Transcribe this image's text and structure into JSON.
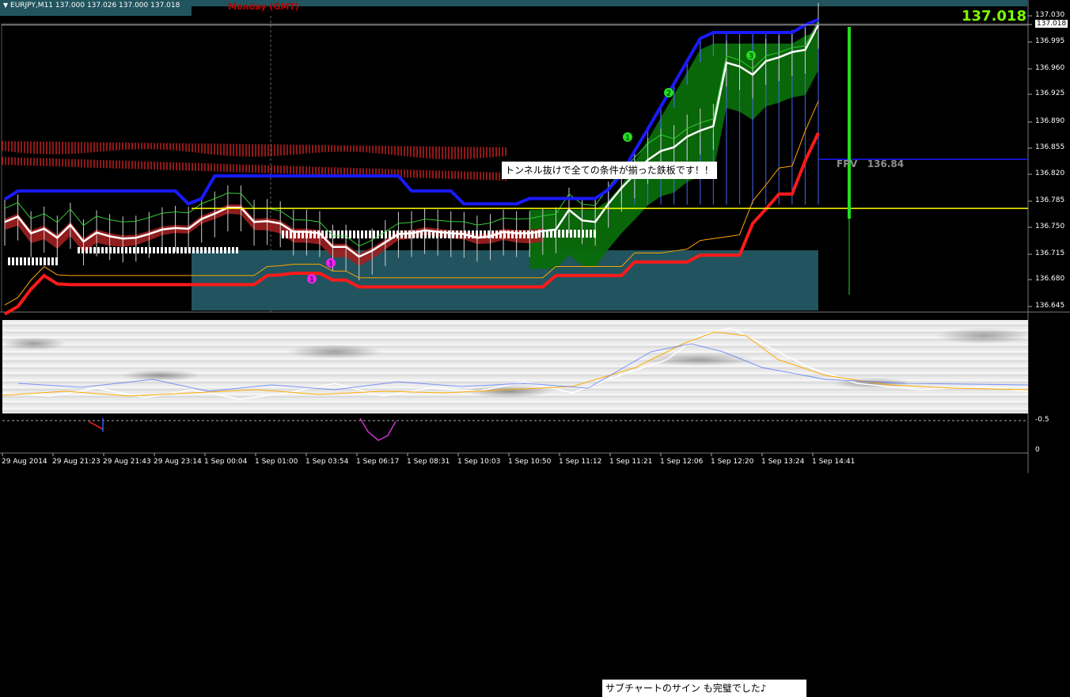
{
  "window": {
    "symbol_line": "EURJPY,M11  137.000 137.026 137.000 137.018",
    "session_label": "Monday    (GMT)",
    "current_price": "137.018",
    "fpv_label": "FPV   136.84"
  },
  "annotations": {
    "main_note": "トンネル抜けで全ての条件が揃った鉄板です！！",
    "sub_note": "サブチャートのサイン も完璧でした♪"
  },
  "signals": [
    {
      "label": "1",
      "color": "#22dd22"
    },
    {
      "label": "2",
      "color": "#22dd22"
    },
    {
      "label": "3",
      "color": "#22dd22"
    },
    {
      "label": "1",
      "color": "#ee22ee"
    },
    {
      "label": "1",
      "color": "#ee22ee"
    }
  ],
  "colors": {
    "background": "#000000",
    "upper_band": "#1a1aff",
    "lower_band": "#ff1a1a",
    "price_line": "#ffffff",
    "cloud_bull": "#0a6b0a",
    "cloud_bear": "#a02020",
    "teal_zone": "#21545e",
    "fpv_line": "#1a1aff",
    "yellow_line": "#ffff00",
    "current_price": "#7cfc00"
  },
  "chart_data": {
    "type": "line",
    "title": "EURJPY,M11",
    "y_axis_ticks": [
      "137.030",
      "137.018",
      "136.995",
      "136.960",
      "136.925",
      "136.890",
      "136.855",
      "136.820",
      "136.785",
      "136.750",
      "136.715",
      "136.680",
      "136.645"
    ],
    "sub_axis_ticks": [
      "-0.5",
      "0"
    ],
    "x_axis_ticks": [
      "29 Aug 2014",
      "29 Aug 21:23",
      "29 Aug 21:43",
      "29 Aug 23:14",
      "1 Sep 00:04",
      "1 Sep 01:00",
      "1 Sep 03:54",
      "1 Sep 06:17",
      "1 Sep 08:31",
      "1 Sep 10:03",
      "1 Sep 10:50",
      "1 Sep 11:12",
      "1 Sep 11:21",
      "1 Sep 12:06",
      "1 Sep 12:20",
      "1 Sep 13:24",
      "1 Sep 14:41"
    ],
    "ylim": [
      136.645,
      137.03
    ],
    "current_price": 137.018,
    "fpv": 136.84,
    "yellow_level": 136.775,
    "series": [
      {
        "values": [
          136.757,
          136.764,
          136.742,
          136.748,
          136.736,
          136.753,
          136.731,
          136.743,
          136.738,
          136.735,
          136.736,
          136.741,
          136.747,
          136.749,
          136.748,
          136.761,
          136.768,
          136.776,
          136.776,
          136.757,
          136.758,
          136.755,
          136.744,
          136.744,
          136.742,
          136.724,
          136.724,
          136.711,
          136.719,
          136.73,
          136.741,
          136.742,
          136.746,
          136.744,
          136.742,
          136.741,
          136.736,
          136.738,
          136.744,
          136.742,
          136.742,
          136.745,
          136.747,
          136.773,
          136.759,
          136.757,
          136.781,
          136.802,
          136.82,
          136.839,
          136.851,
          136.856,
          136.87,
          136.878,
          136.884,
          136.968,
          136.963,
          136.952,
          136.97,
          136.975,
          136.982,
          136.985,
          137.018
        ]
      },
      {
        "values": [
          136.787,
          136.798,
          136.798,
          136.798,
          136.798,
          136.798,
          136.798,
          136.798,
          136.798,
          136.798,
          136.798,
          136.798,
          136.798,
          136.798,
          136.781,
          136.788,
          136.818,
          136.818,
          136.818,
          136.818,
          136.818,
          136.818,
          136.818,
          136.818,
          136.818,
          136.818,
          136.818,
          136.818,
          136.818,
          136.818,
          136.818,
          136.798,
          136.798,
          136.798,
          136.798,
          136.781,
          136.781,
          136.781,
          136.781,
          136.781,
          136.788,
          136.788,
          136.788,
          136.788,
          136.788,
          136.788,
          136.8,
          136.82,
          136.851,
          136.88,
          136.91,
          136.94,
          136.97,
          137.0,
          137.008,
          137.008,
          137.008,
          137.008,
          137.008,
          137.008,
          137.008,
          137.018,
          137.025
        ]
      },
      {
        "values": [
          136.635,
          136.645,
          136.668,
          136.686,
          136.675,
          136.674,
          136.674,
          136.674,
          136.674,
          136.674,
          136.674,
          136.674,
          136.674,
          136.674,
          136.674,
          136.674,
          136.674,
          136.674,
          136.674,
          136.674,
          136.686,
          136.687,
          136.689,
          136.689,
          136.689,
          136.68,
          136.68,
          136.671,
          136.671,
          136.671,
          136.671,
          136.671,
          136.671,
          136.671,
          136.671,
          136.671,
          136.671,
          136.671,
          136.671,
          136.671,
          136.671,
          136.671,
          136.686,
          136.686,
          136.686,
          136.686,
          136.686,
          136.686,
          136.704,
          136.704,
          136.704,
          136.704,
          136.704,
          136.713,
          136.713,
          136.713,
          136.713,
          136.755,
          136.774,
          136.794,
          136.794,
          136.838,
          136.875
        ]
      }
    ]
  }
}
